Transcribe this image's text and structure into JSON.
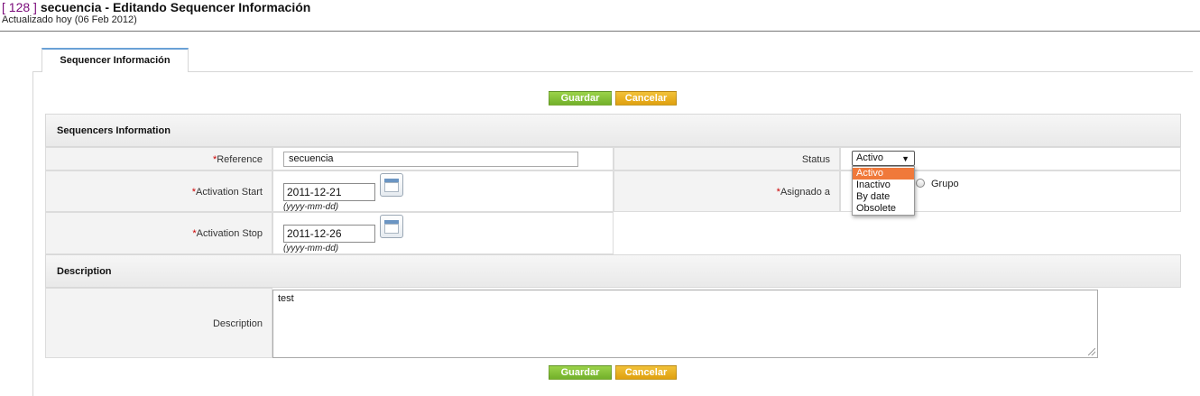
{
  "header": {
    "record_id": "[ 128 ]",
    "title": "secuencia - Editando Sequencer Información",
    "subtitle": "Actualizado hoy (06 Feb 2012)"
  },
  "tabs": [
    {
      "label": "Sequencer Información"
    }
  ],
  "toolbar": {
    "save_label": "Guardar",
    "cancel_label": "Cancelar"
  },
  "sections": {
    "info": {
      "title": "Sequencers Information",
      "reference": {
        "label": "Reference",
        "value": "secuencia"
      },
      "activation_start": {
        "label": "Activation Start",
        "value": "2011-12-21",
        "hint": "(yyyy-mm-dd)"
      },
      "activation_stop": {
        "label": "Activation Stop",
        "value": "2011-12-26",
        "hint": "(yyyy-mm-dd)"
      },
      "status": {
        "label": "Status",
        "selected": "Activo",
        "options": [
          "Activo",
          "Inactivo",
          "By date",
          "Obsolete"
        ]
      },
      "assigned_to": {
        "label": "Asignado a",
        "radio_label": "Grupo"
      }
    },
    "description": {
      "title": "Description",
      "label": "Description",
      "value": "test"
    }
  },
  "required_marker": "*",
  "colors": {
    "save_button": "#84c336",
    "cancel_button": "#e8b020",
    "tab_accent": "#6aa1d6",
    "dropdown_highlight": "#f0793a",
    "record_id": "#7a0a7a"
  },
  "icons": [
    "calendar-icon",
    "dropdown-arrow-icon",
    "radio-icon",
    "resize-grip-icon"
  ]
}
